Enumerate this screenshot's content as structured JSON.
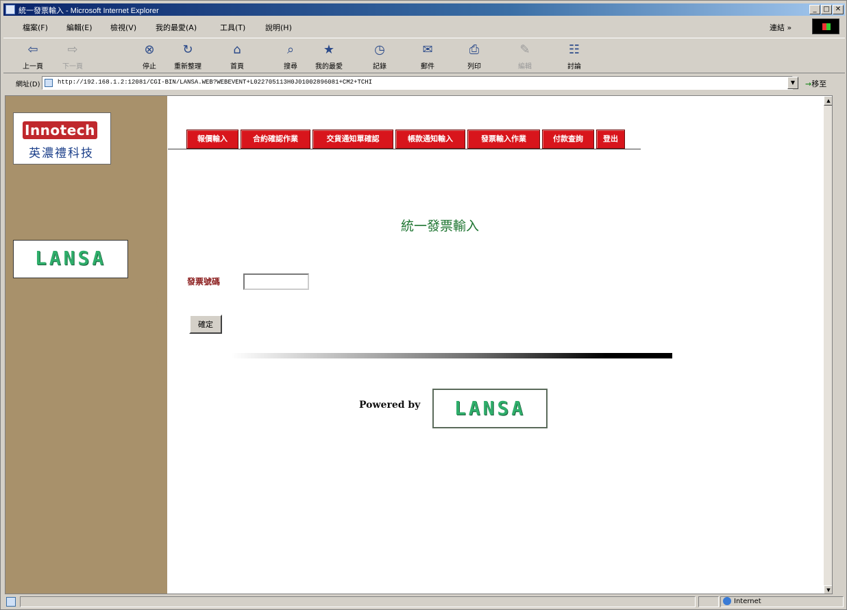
{
  "window": {
    "title": "統一發票輸入 - Microsoft Internet Explorer",
    "controls": {
      "minimize": "_",
      "maximize": "□",
      "close": "✕"
    }
  },
  "menubar": {
    "items": [
      "檔案(F)",
      "編輯(E)",
      "檢視(V)",
      "我的最愛(A)",
      "工具(T)",
      "說明(H)"
    ],
    "links_label": "連結 »"
  },
  "toolbar": {
    "buttons": [
      {
        "label": "上一頁",
        "icon": "back-arrow-icon",
        "glyph": "⇦",
        "enabled": true
      },
      {
        "label": "下一頁",
        "icon": "forward-arrow-icon",
        "glyph": "⇨",
        "enabled": false
      },
      {
        "label": "停止",
        "icon": "stop-icon",
        "glyph": "⊗",
        "enabled": true
      },
      {
        "label": "重新整理",
        "icon": "refresh-icon",
        "glyph": "↻",
        "enabled": true
      },
      {
        "label": "首頁",
        "icon": "home-icon",
        "glyph": "⌂",
        "enabled": true
      },
      {
        "label": "搜尋",
        "icon": "search-icon",
        "glyph": "⌕",
        "enabled": true
      },
      {
        "label": "我的最愛",
        "icon": "favorites-icon",
        "glyph": "★",
        "enabled": true
      },
      {
        "label": "記錄",
        "icon": "history-icon",
        "glyph": "◷",
        "enabled": true
      },
      {
        "label": "郵件",
        "icon": "mail-icon",
        "glyph": "✉",
        "enabled": true
      },
      {
        "label": "列印",
        "icon": "print-icon",
        "glyph": "⎙",
        "enabled": true
      },
      {
        "label": "編輯",
        "icon": "edit-icon",
        "glyph": "✎",
        "enabled": false
      },
      {
        "label": "討論",
        "icon": "discuss-icon",
        "glyph": "☷",
        "enabled": true
      }
    ]
  },
  "addressbar": {
    "label": "網址(D)",
    "url": "http://192.168.1.2:12081/CGI-BIN/LANSA.WEB?WEBEVENT+L022705113H0J01002896081+CM2+TCHI",
    "go_label": "移至"
  },
  "sidebar": {
    "logo_top": "Innotech",
    "logo_bottom": "英濃禮科技",
    "lansa_logo": "LANSA"
  },
  "nav": {
    "tabs": [
      "報價輸入",
      "合約確認作業",
      "交貨通知單確認",
      "帳款通知輸入",
      "發票輸入作業",
      "付款查詢",
      "登出"
    ]
  },
  "main": {
    "title": "統一發票輸入",
    "invoice_label": "發票號碼",
    "invoice_value": "",
    "submit_label": "確定",
    "powered_by": "Powered by",
    "footer_logo": "LANSA"
  },
  "statusbar": {
    "zone": "Internet"
  },
  "colors": {
    "sidebar_bg": "#a8916b",
    "nav_tab": "#d8151c",
    "title_green": "#1d7430",
    "label_maroon": "#8b1d1d",
    "lansa_green": "#2fae6b"
  }
}
